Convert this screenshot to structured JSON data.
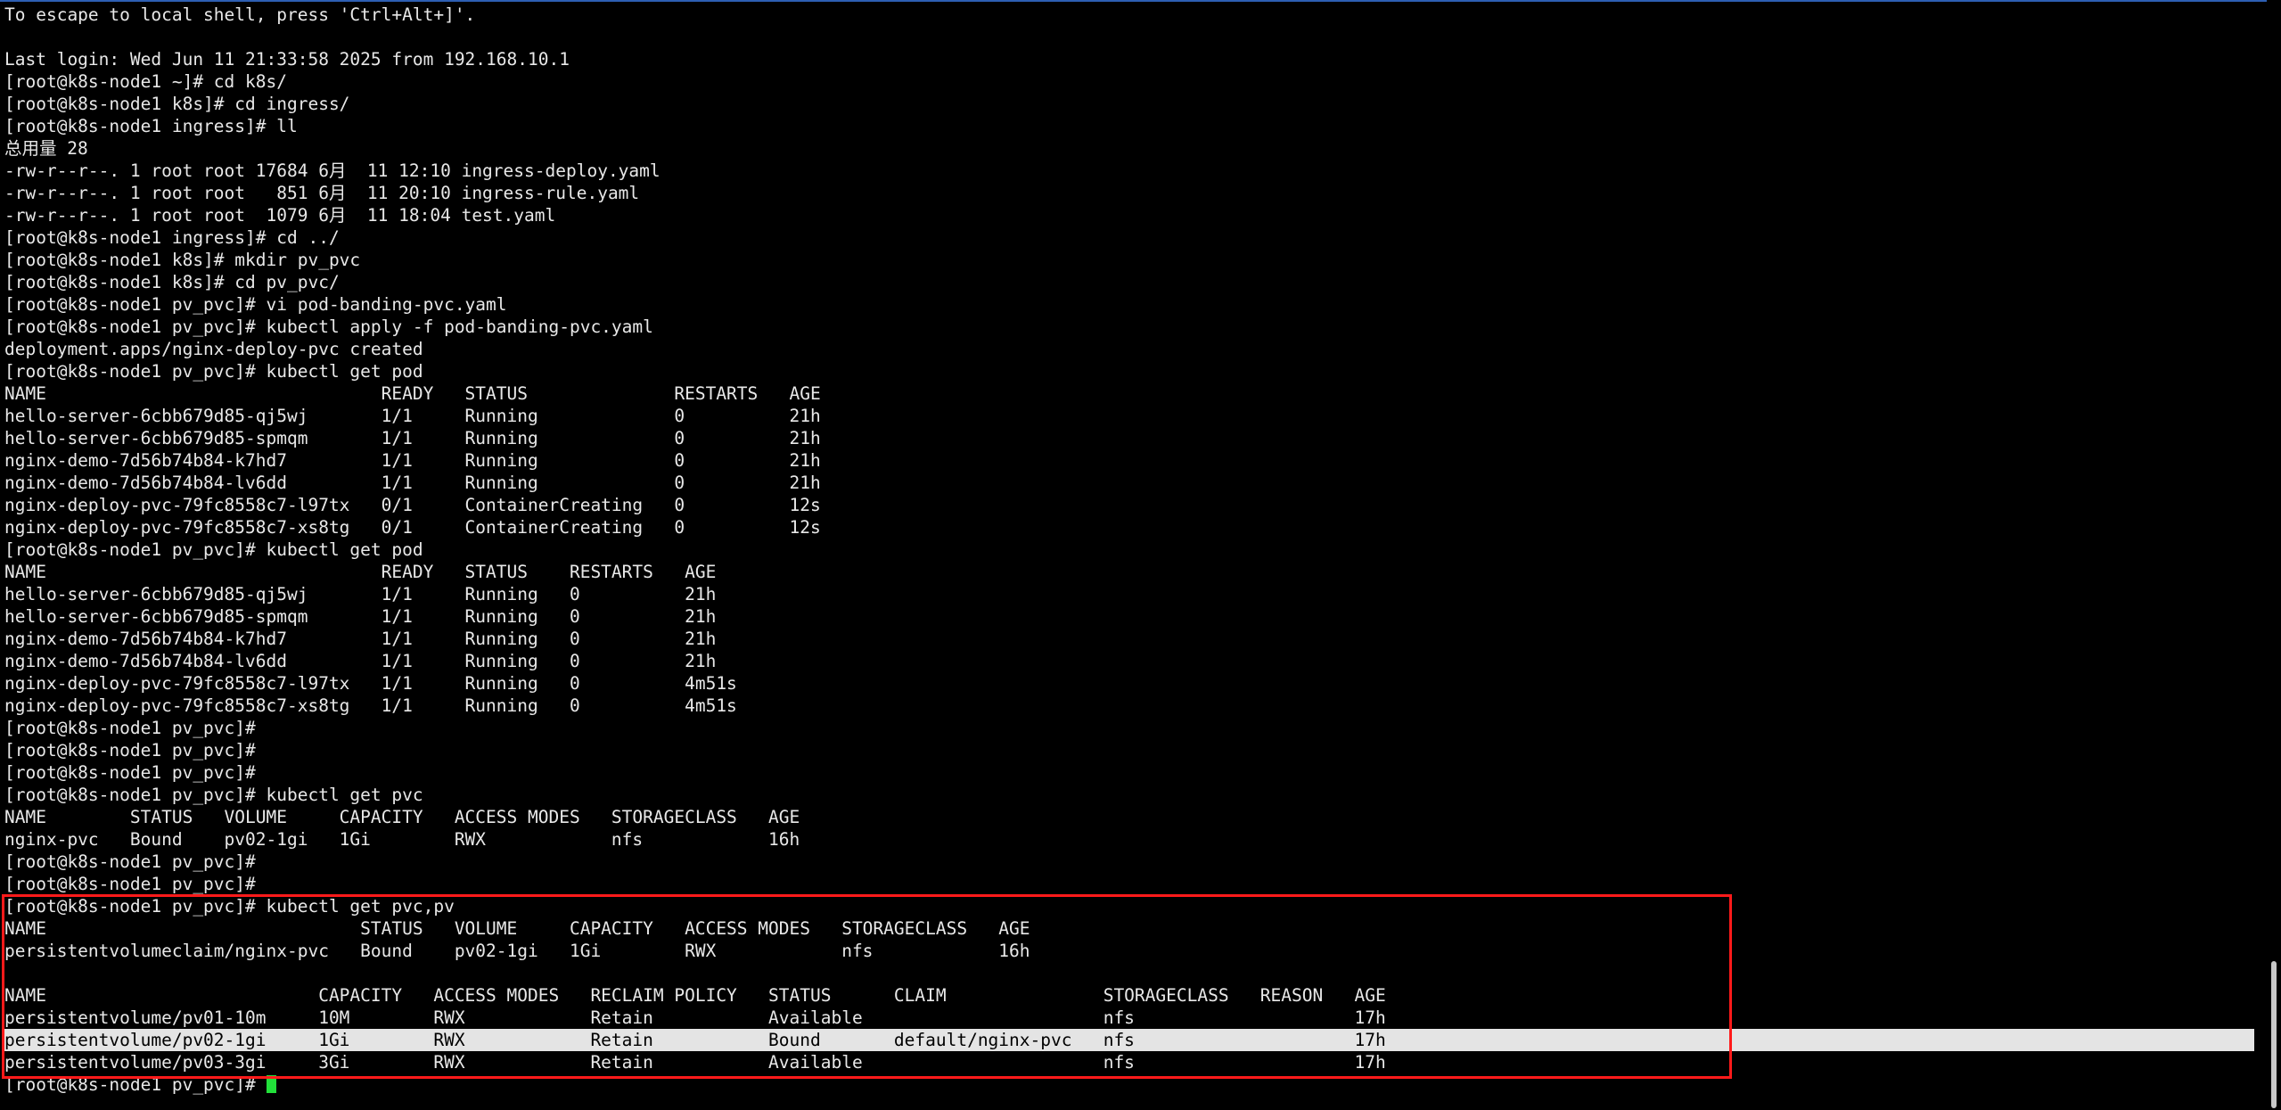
{
  "terminal": {
    "lines": [
      "To escape to local shell, press 'Ctrl+Alt+]'.",
      "",
      "Last login: Wed Jun 11 21:33:58 2025 from 192.168.10.1",
      "[root@k8s-node1 ~]# cd k8s/",
      "[root@k8s-node1 k8s]# cd ingress/",
      "[root@k8s-node1 ingress]# ll",
      "总用量 28",
      "-rw-r--r--. 1 root root 17684 6月  11 12:10 ingress-deploy.yaml",
      "-rw-r--r--. 1 root root   851 6月  11 20:10 ingress-rule.yaml",
      "-rw-r--r--. 1 root root  1079 6月  11 18:04 test.yaml",
      "[root@k8s-node1 ingress]# cd ../",
      "[root@k8s-node1 k8s]# mkdir pv_pvc",
      "[root@k8s-node1 k8s]# cd pv_pvc/",
      "[root@k8s-node1 pv_pvc]# vi pod-banding-pvc.yaml",
      "[root@k8s-node1 pv_pvc]# kubectl apply -f pod-banding-pvc.yaml",
      "deployment.apps/nginx-deploy-pvc created",
      "[root@k8s-node1 pv_pvc]# kubectl get pod",
      "NAME                                READY   STATUS              RESTARTS   AGE",
      "hello-server-6cbb679d85-qj5wj       1/1     Running             0          21h",
      "hello-server-6cbb679d85-spmqm       1/1     Running             0          21h",
      "nginx-demo-7d56b74b84-k7hd7         1/1     Running             0          21h",
      "nginx-demo-7d56b74b84-lv6dd         1/1     Running             0          21h",
      "nginx-deploy-pvc-79fc8558c7-l97tx   0/1     ContainerCreating   0          12s",
      "nginx-deploy-pvc-79fc8558c7-xs8tg   0/1     ContainerCreating   0          12s",
      "[root@k8s-node1 pv_pvc]# kubectl get pod",
      "NAME                                READY   STATUS    RESTARTS   AGE",
      "hello-server-6cbb679d85-qj5wj       1/1     Running   0          21h",
      "hello-server-6cbb679d85-spmqm       1/1     Running   0          21h",
      "nginx-demo-7d56b74b84-k7hd7         1/1     Running   0          21h",
      "nginx-demo-7d56b74b84-lv6dd         1/1     Running   0          21h",
      "nginx-deploy-pvc-79fc8558c7-l97tx   1/1     Running   0          4m51s",
      "nginx-deploy-pvc-79fc8558c7-xs8tg   1/1     Running   0          4m51s",
      "[root@k8s-node1 pv_pvc]#",
      "[root@k8s-node1 pv_pvc]#",
      "[root@k8s-node1 pv_pvc]#",
      "[root@k8s-node1 pv_pvc]# kubectl get pvc",
      "NAME        STATUS   VOLUME     CAPACITY   ACCESS MODES   STORAGECLASS   AGE",
      "nginx-pvc   Bound    pv02-1gi   1Gi        RWX            nfs            16h",
      "[root@k8s-node1 pv_pvc]#",
      "[root@k8s-node1 pv_pvc]#",
      "[root@k8s-node1 pv_pvc]# kubectl get pvc,pv",
      "NAME                              STATUS   VOLUME     CAPACITY   ACCESS MODES   STORAGECLASS   AGE",
      "persistentvolumeclaim/nginx-pvc   Bound    pv02-1gi   1Gi        RWX            nfs            16h",
      "",
      "NAME                          CAPACITY   ACCESS MODES   RECLAIM POLICY   STATUS      CLAIM               STORAGECLASS   REASON   AGE",
      "persistentvolume/pv01-10m     10M        RWX            Retain           Available                       nfs                     17h",
      "persistentvolume/pv02-1gi     1Gi        RWX            Retain           Bound       default/nginx-pvc   nfs                     17h",
      "persistentvolume/pv03-3gi     3Gi        RWX            Retain           Available                       nfs                     17h"
    ],
    "prompt": "[root@k8s-node1 pv_pvc]# "
  },
  "colors": {
    "background": "#000000",
    "foreground": "#e8e8e8",
    "selection_highlight": "#e4e4e4",
    "annotation_box": "#ff1a1a",
    "cursor": "#22e03a"
  }
}
